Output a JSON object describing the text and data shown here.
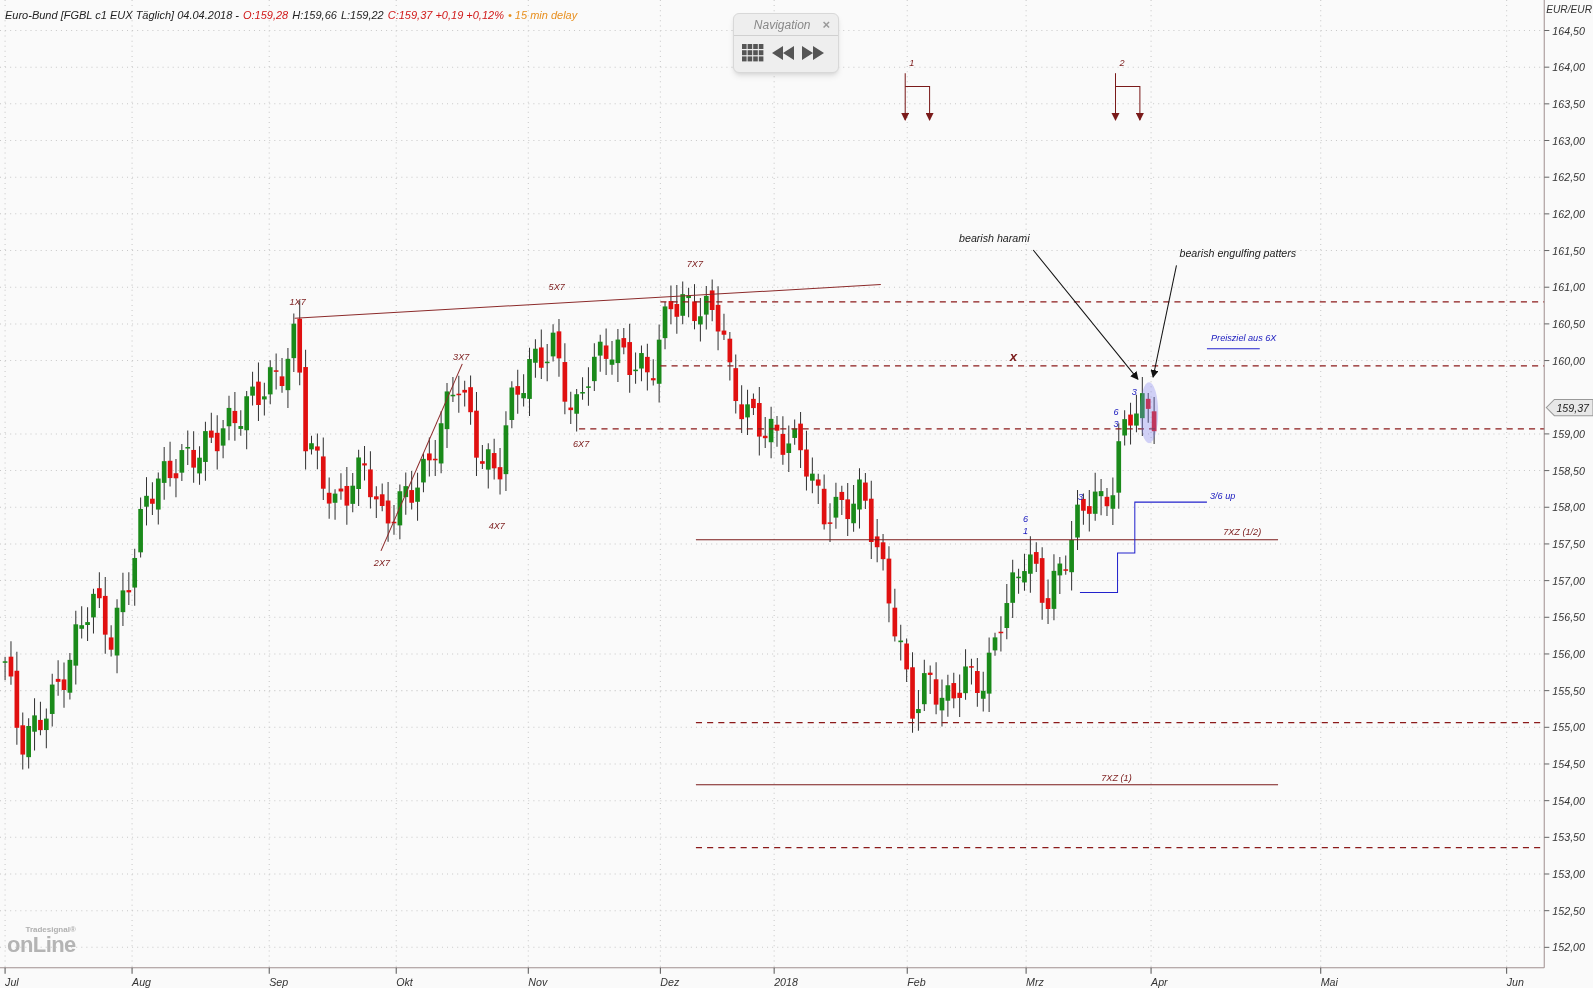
{
  "header": {
    "instrument": "Euro-Bund [FGBL c1 EUX Täglich] 04.04.2018 -",
    "open": "O:159,28",
    "high": "H:159,66",
    "low": "L:159,22",
    "close": "C:159,37 +0,19 +0,12%",
    "delay": "• 15 min delay"
  },
  "navigation": {
    "title": "Navigation",
    "close": "×"
  },
  "y_axis": {
    "unit": "EUR/EUR",
    "labels": [
      "164,50",
      "164,00",
      "163,50",
      "163,00",
      "162,50",
      "162,00",
      "161,50",
      "161,00",
      "160,50",
      "160,00",
      "159,00",
      "158,50",
      "158,00",
      "157,50",
      "157,00",
      "156,50",
      "156,00",
      "155,50",
      "155,00",
      "154,50",
      "154,00",
      "153,50",
      "153,00",
      "152,50",
      "152,00"
    ],
    "price_marker": "159,37"
  },
  "x_axis": {
    "labels": [
      "Jul",
      "Aug",
      "Sep",
      "Okt",
      "Nov",
      "Dez",
      "2018",
      "Feb",
      "Mrz",
      "Apr",
      "Mai",
      "Jun"
    ]
  },
  "annotations": [
    {
      "text": "1X7",
      "kind": "pattern"
    },
    {
      "text": "5X7",
      "kind": "pattern"
    },
    {
      "text": "7X7",
      "kind": "pattern"
    },
    {
      "text": "3X7",
      "kind": "pattern"
    },
    {
      "text": "6X7",
      "kind": "pattern"
    },
    {
      "text": "4X7",
      "kind": "pattern"
    },
    {
      "text": "2X7",
      "kind": "pattern"
    },
    {
      "text": "x",
      "kind": "pattern"
    },
    {
      "text": "1",
      "kind": "pattern"
    },
    {
      "text": "2",
      "kind": "pattern"
    },
    {
      "text": "bearish harami",
      "kind": "note"
    },
    {
      "text": "bearish engulfing patters",
      "kind": "note"
    },
    {
      "text": "Preisziel aus 6X",
      "kind": "count"
    },
    {
      "text": "3/6 up",
      "kind": "count"
    },
    {
      "text": "7XZ (1/2)",
      "kind": "pattern"
    },
    {
      "text": "7XZ (1)",
      "kind": "pattern"
    },
    {
      "text": "6",
      "kind": "count"
    },
    {
      "text": "1",
      "kind": "count"
    },
    {
      "text": "3",
      "kind": "count"
    },
    {
      "text": "6",
      "kind": "count"
    },
    {
      "text": "3",
      "kind": "count"
    },
    {
      "text": "3",
      "kind": "count"
    }
  ],
  "logo": {
    "small": "Tradesignal®",
    "large": "onLine"
  }
}
